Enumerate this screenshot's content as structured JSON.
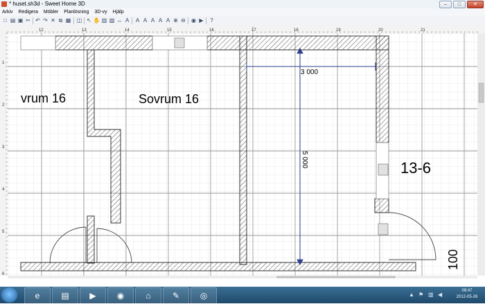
{
  "window": {
    "title": "* huset.sh3d - Sweet Home 3D",
    "min": "–",
    "max": "□",
    "close": "✕"
  },
  "menu": [
    "Arkiv",
    "Redigera",
    "Möbler",
    "Planlösning",
    "3D-vy",
    "Hjälp"
  ],
  "toolbar": {
    "icons": [
      "new-icon",
      "open-icon",
      "save-icon",
      "cut-icon",
      "undo-icon",
      "redo-icon",
      "delete-icon",
      "copy-icon",
      "paste-icon",
      "add-furniture-icon",
      "select-icon",
      "pan-icon",
      "create-walls-icon",
      "create-rooms-icon",
      "create-dimensions-icon",
      "create-labels-icon",
      "text-style-icon",
      "bold-icon",
      "italic-icon",
      "increase-text-icon",
      "decrease-text-icon",
      "zoom-in-icon",
      "zoom-out-icon",
      "create-photo-icon",
      "create-video-icon",
      "help-icon"
    ]
  },
  "plan": {
    "ruler_labels": [
      "12",
      "13",
      "14",
      "15",
      "16",
      "17",
      "18",
      "19",
      "20",
      "21"
    ],
    "left_ruler_labels": [
      "1",
      "2",
      "3",
      "4",
      "5",
      "6"
    ],
    "rooms": [
      {
        "name": "vrum 16"
      },
      {
        "name": "Sovrum 16"
      },
      {
        "name": "13-6"
      }
    ],
    "dimensions": {
      "horizontal": "3 000",
      "vertical": "5 000",
      "bottom_right": "100"
    }
  },
  "taskbar": {
    "apps": [
      "windows-explorer-icon",
      "ie-icon",
      "explorer-folder-icon",
      "media-player-icon",
      "spotify-icon",
      "sweet-home-icon",
      "paint-icon",
      "chrome-icon"
    ],
    "time": "09:47",
    "date": "2012-05-26"
  }
}
